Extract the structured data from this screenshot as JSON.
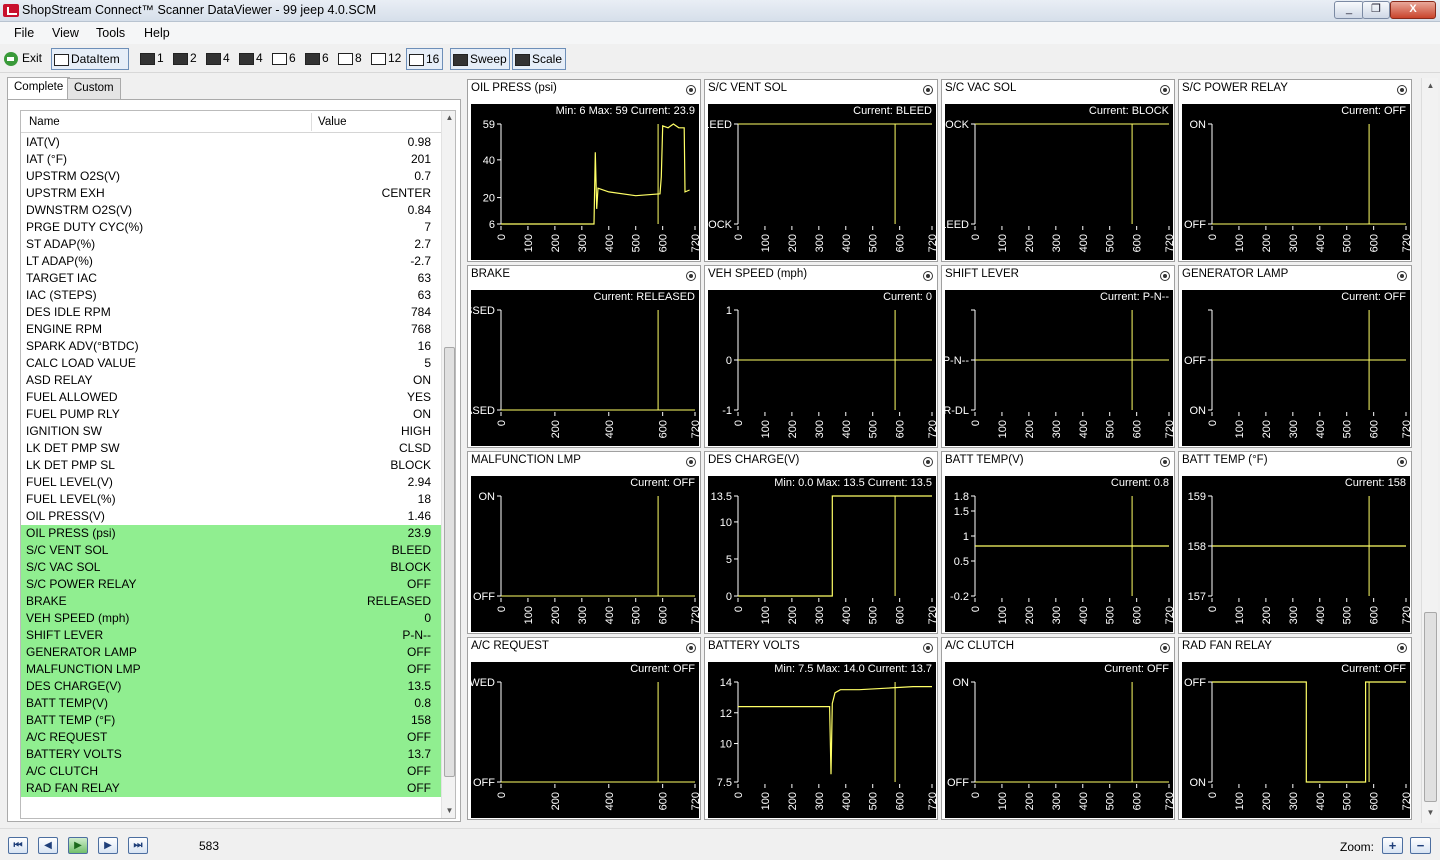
{
  "window": {
    "title": "ShopStream Connect™ Scanner DataViewer - 99 jeep 4.0.SCM",
    "controls": [
      "_",
      "❐",
      "X"
    ]
  },
  "menu": [
    "File",
    "View",
    "Tools",
    "Help"
  ],
  "toolbar": {
    "exit": "Exit",
    "dataitem": "DataItem",
    "layouts": [
      "1",
      "2",
      "4",
      "4",
      "6",
      "6",
      "8",
      "12",
      "16"
    ],
    "sweep": "Sweep",
    "scale": "Scale"
  },
  "tabs": [
    "Complete",
    "Custom"
  ],
  "list": {
    "col_name": "Name",
    "col_value": "Value",
    "items": [
      {
        "name": "IAT(V)",
        "value": "0.98",
        "hl": false
      },
      {
        "name": "IAT (°F)",
        "value": "201",
        "hl": false
      },
      {
        "name": "UPSTRM O2S(V)",
        "value": "0.7",
        "hl": false
      },
      {
        "name": "UPSTRM EXH",
        "value": "CENTER",
        "hl": false
      },
      {
        "name": "DWNSTRM O2S(V)",
        "value": "0.84",
        "hl": false
      },
      {
        "name": "PRGE DUTY CYC(%)",
        "value": "7",
        "hl": false
      },
      {
        "name": "ST ADAP(%)",
        "value": "2.7",
        "hl": false
      },
      {
        "name": "LT ADAP(%)",
        "value": "-2.7",
        "hl": false
      },
      {
        "name": "TARGET IAC",
        "value": "63",
        "hl": false
      },
      {
        "name": "IAC (STEPS)",
        "value": "63",
        "hl": false
      },
      {
        "name": "DES IDLE RPM",
        "value": "784",
        "hl": false
      },
      {
        "name": "ENGINE RPM",
        "value": "768",
        "hl": false
      },
      {
        "name": "SPARK ADV(°BTDC)",
        "value": "16",
        "hl": false
      },
      {
        "name": "CALC LOAD VALUE",
        "value": "5",
        "hl": false
      },
      {
        "name": "ASD RELAY",
        "value": "ON",
        "hl": false
      },
      {
        "name": "FUEL ALLOWED",
        "value": "YES",
        "hl": false
      },
      {
        "name": "FUEL PUMP RLY",
        "value": "ON",
        "hl": false
      },
      {
        "name": "IGNITION SW",
        "value": "HIGH",
        "hl": false
      },
      {
        "name": "LK DET PMP SW",
        "value": "CLSD",
        "hl": false
      },
      {
        "name": "LK DET PMP SL",
        "value": "BLOCK",
        "hl": false
      },
      {
        "name": "FUEL LEVEL(V)",
        "value": "2.94",
        "hl": false
      },
      {
        "name": "FUEL LEVEL(%)",
        "value": "18",
        "hl": false
      },
      {
        "name": "OIL PRESS(V)",
        "value": "1.46",
        "hl": false
      },
      {
        "name": "OIL PRESS (psi)",
        "value": "23.9",
        "hl": true
      },
      {
        "name": "S/C VENT SOL",
        "value": "BLEED",
        "hl": true
      },
      {
        "name": "S/C VAC SOL",
        "value": "BLOCK",
        "hl": true
      },
      {
        "name": "S/C POWER RELAY",
        "value": "OFF",
        "hl": true
      },
      {
        "name": "BRAKE",
        "value": "RELEASED",
        "hl": true
      },
      {
        "name": "VEH SPEED (mph)",
        "value": "0",
        "hl": true
      },
      {
        "name": "SHIFT LEVER",
        "value": "P-N--",
        "hl": true
      },
      {
        "name": "GENERATOR LAMP",
        "value": "OFF",
        "hl": true
      },
      {
        "name": "MALFUNCTION LMP",
        "value": "OFF",
        "hl": true
      },
      {
        "name": "DES CHARGE(V)",
        "value": "13.5",
        "hl": true
      },
      {
        "name": "BATT TEMP(V)",
        "value": "0.8",
        "hl": true
      },
      {
        "name": "BATT TEMP (°F)",
        "value": "158",
        "hl": true
      },
      {
        "name": "A/C REQUEST",
        "value": "OFF",
        "hl": true
      },
      {
        "name": "BATTERY VOLTS",
        "value": "13.7",
        "hl": true
      },
      {
        "name": "A/C CLUTCH",
        "value": "OFF",
        "hl": true
      },
      {
        "name": "RAD FAN RELAY",
        "value": "OFF",
        "hl": true
      }
    ]
  },
  "graphs": [
    {
      "title": "OIL PRESS (psi)",
      "kind": "num",
      "min": "6",
      "max": "59",
      "current": "23.9",
      "yticks": [
        59,
        40,
        20,
        6
      ],
      "ylim": [
        6,
        59
      ],
      "xticks": [
        0,
        100,
        200,
        300,
        400,
        500,
        600,
        720
      ],
      "trace": [
        [
          0,
          6
        ],
        [
          345,
          6
        ],
        [
          350,
          44
        ],
        [
          355,
          14
        ],
        [
          360,
          25
        ],
        [
          400,
          23
        ],
        [
          500,
          21
        ],
        [
          590,
          22
        ],
        [
          595,
          31
        ],
        [
          600,
          58
        ],
        [
          620,
          57
        ],
        [
          640,
          59
        ],
        [
          660,
          57
        ],
        [
          680,
          57
        ],
        [
          683,
          23
        ],
        [
          700,
          24
        ]
      ],
      "cursor": 583
    },
    {
      "title": "S/C VENT SOL",
      "kind": "state",
      "current": "BLEED",
      "ylabels": [
        "BLEED",
        "BLOCK"
      ],
      "value_level": 0,
      "xticks": [
        0,
        100,
        200,
        300,
        400,
        500,
        600,
        720
      ],
      "cursor": 583
    },
    {
      "title": "S/C VAC SOL",
      "kind": "state",
      "current": "BLOCK",
      "ylabels": [
        "BLOCK",
        "BLEED"
      ],
      "value_level": 0,
      "xticks": [
        0,
        100,
        200,
        300,
        400,
        500,
        600,
        720
      ],
      "cursor": 583
    },
    {
      "title": "S/C POWER RELAY",
      "kind": "state",
      "current": "OFF",
      "ylabels": [
        "ON",
        "OFF"
      ],
      "value_level": 1,
      "xticks": [
        0,
        100,
        200,
        300,
        400,
        500,
        600,
        720
      ],
      "cursor": 583
    },
    {
      "title": "BRAKE",
      "kind": "state",
      "current": "RELEASED",
      "ylabels": [
        "PRESSED",
        "RELEASED"
      ],
      "value_level": 1,
      "xticks": [
        0,
        200,
        400,
        600,
        720
      ],
      "cursor": 583
    },
    {
      "title": "VEH SPEED (mph)",
      "kind": "state",
      "current": "0",
      "ylabels": [
        "1",
        "0",
        "-1"
      ],
      "value_level": 1,
      "xticks": [
        0,
        100,
        200,
        300,
        400,
        500,
        600,
        720
      ],
      "cursor": 583
    },
    {
      "title": "SHIFT LEVER",
      "kind": "state",
      "current": "P-N--",
      "ylabels": [
        "",
        "P-N--",
        "-R-DL"
      ],
      "value_level": 1,
      "xticks": [
        0,
        100,
        200,
        300,
        400,
        500,
        600,
        720
      ],
      "cursor": 583
    },
    {
      "title": "GENERATOR LAMP",
      "kind": "state",
      "current": "OFF",
      "ylabels": [
        "",
        "OFF",
        "ON"
      ],
      "value_level": 1,
      "xticks": [
        0,
        100,
        200,
        300,
        400,
        500,
        600,
        720
      ],
      "cursor": 583
    },
    {
      "title": "MALFUNCTION LMP",
      "kind": "state",
      "current": "OFF",
      "ylabels": [
        "ON",
        "OFF"
      ],
      "value_level": 1,
      "xticks": [
        0,
        100,
        200,
        300,
        400,
        500,
        600,
        720
      ],
      "cursor": 583
    },
    {
      "title": "DES CHARGE(V)",
      "kind": "num",
      "min": "0.0",
      "max": "13.5",
      "current": "13.5",
      "yticks": [
        13.5,
        10.0,
        5.0,
        0.0
      ],
      "ylim": [
        0,
        13.5
      ],
      "xticks": [
        0,
        100,
        200,
        300,
        400,
        500,
        600,
        720
      ],
      "trace": [
        [
          0,
          0
        ],
        [
          350,
          0
        ],
        [
          350,
          13.5
        ],
        [
          720,
          13.5
        ]
      ],
      "cursor": 583
    },
    {
      "title": "BATT TEMP(V)",
      "kind": "num",
      "current": "0.8",
      "yticks": [
        1.8,
        1.5,
        1.0,
        0.5,
        -0.2
      ],
      "ylim": [
        -0.2,
        1.8
      ],
      "xticks": [
        0,
        100,
        200,
        300,
        400,
        500,
        600,
        720
      ],
      "trace": [
        [
          0,
          0.8
        ],
        [
          720,
          0.8
        ]
      ],
      "cursor": 583
    },
    {
      "title": "BATT TEMP (°F)",
      "kind": "num",
      "current": "158",
      "yticks": [
        159,
        158,
        157
      ],
      "ylim": [
        157,
        159
      ],
      "xticks": [
        0,
        100,
        200,
        300,
        400,
        500,
        600,
        720
      ],
      "trace": [
        [
          0,
          158
        ],
        [
          720,
          158
        ]
      ],
      "cursor": 583
    },
    {
      "title": "A/C REQUEST",
      "kind": "state",
      "current": "OFF",
      "ylabels": [
        "ALLOWED",
        "OFF"
      ],
      "value_level": 1,
      "xticks": [
        0,
        200,
        400,
        600,
        720
      ],
      "cursor": 583
    },
    {
      "title": "BATTERY VOLTS",
      "kind": "num",
      "min": "7.5",
      "max": "14.0",
      "current": "13.7",
      "yticks": [
        14.0,
        12.0,
        10.0,
        7.5
      ],
      "ylim": [
        7.5,
        14
      ],
      "xticks": [
        0,
        100,
        200,
        300,
        400,
        500,
        600,
        720
      ],
      "trace": [
        [
          0,
          12.4
        ],
        [
          200,
          12.4
        ],
        [
          300,
          12.4
        ],
        [
          340,
          12.4
        ],
        [
          345,
          8
        ],
        [
          350,
          12.6
        ],
        [
          360,
          13.3
        ],
        [
          380,
          13.5
        ],
        [
          450,
          13.5
        ],
        [
          550,
          13.6
        ],
        [
          650,
          13.7
        ],
        [
          720,
          13.7
        ]
      ],
      "cursor": 583
    },
    {
      "title": "A/C CLUTCH",
      "kind": "state",
      "current": "OFF",
      "ylabels": [
        "ON",
        "OFF"
      ],
      "value_level": 1,
      "xticks": [
        0,
        100,
        200,
        300,
        400,
        500,
        600,
        720
      ],
      "cursor": 583
    },
    {
      "title": "RAD FAN RELAY",
      "kind": "step",
      "current": "OFF",
      "ylabels": [
        "OFF",
        "ON"
      ],
      "xticks": [
        0,
        100,
        200,
        300,
        400,
        500,
        600,
        720
      ],
      "trace": [
        [
          0,
          0
        ],
        [
          350,
          0
        ],
        [
          350,
          1
        ],
        [
          570,
          1
        ],
        [
          570,
          0
        ],
        [
          720,
          0
        ]
      ],
      "cursor": 583
    }
  ],
  "status": {
    "frame": "583",
    "zoom_label": "Zoom:",
    "nav": [
      "first",
      "prev",
      "play",
      "next",
      "last"
    ]
  },
  "colors": {
    "trace": "#ffff66",
    "plot_bg": "#000000",
    "highlight": "#90ee90"
  }
}
